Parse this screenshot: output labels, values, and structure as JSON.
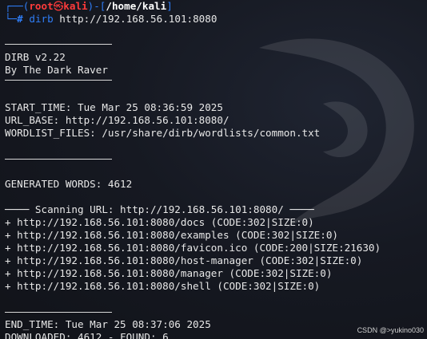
{
  "prompt": {
    "frame_top": "┌──(",
    "user_host_root": "root",
    "skull": "㉿",
    "host": "kali",
    "frame_mid": ")-[",
    "path": "/home/kali",
    "frame_end": "]",
    "frame_bottom": "└─",
    "symbol": "#",
    "command": "dirb",
    "args": "http://192.168.56.101:8080"
  },
  "output": {
    "banner_title": "DIRB v2.22",
    "banner_author": "By The Dark Raver",
    "start_time": "START_TIME: Tue Mar 25 08:36:59 2025",
    "url_base": "URL_BASE: http://192.168.56.101:8080/",
    "wordlist": "WORDLIST_FILES: /usr/share/dirb/wordlists/common.txt",
    "generated_words": "GENERATED WORDS: 4612",
    "scanning": "──── Scanning URL: http://192.168.56.101:8080/ ────",
    "results": [
      "+ http://192.168.56.101:8080/docs (CODE:302|SIZE:0)",
      "+ http://192.168.56.101:8080/examples (CODE:302|SIZE:0)",
      "+ http://192.168.56.101:8080/favicon.ico (CODE:200|SIZE:21630)",
      "+ http://192.168.56.101:8080/host-manager (CODE:302|SIZE:0)",
      "+ http://192.168.56.101:8080/manager (CODE:302|SIZE:0)",
      "+ http://192.168.56.101:8080/shell (CODE:302|SIZE:0)"
    ],
    "end_time": "END_TIME: Tue Mar 25 08:37:06 2025",
    "downloaded": "DOWNLOADED: 4612 - FOUND: 6"
  },
  "watermark_text": "CSDN @>yukino030",
  "colors": {
    "background": "#13151c",
    "prompt_frame": "#2f7df6",
    "root_user": "#ff3b3b",
    "text": "#e8e8e8"
  },
  "icons": {
    "background": "kali-dragon-icon"
  }
}
